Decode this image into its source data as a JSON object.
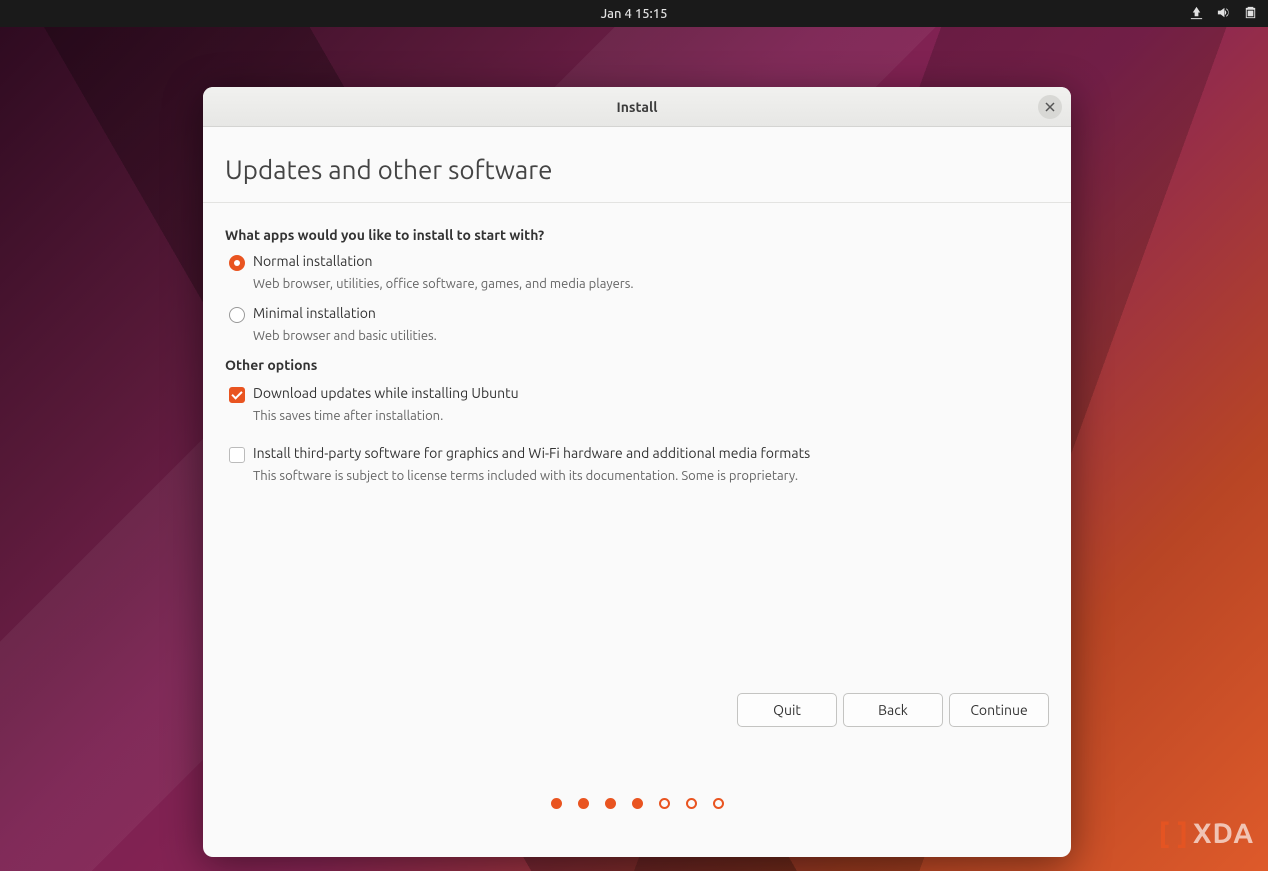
{
  "topbar": {
    "datetime": "Jan 4  15:15"
  },
  "window": {
    "title": "Install"
  },
  "page": {
    "heading": "Updates and other software",
    "question": "What apps would you like to install to start with?",
    "install_options": [
      {
        "label": "Normal installation",
        "desc": "Web browser, utilities, office software, games, and media players.",
        "selected": true
      },
      {
        "label": "Minimal installation",
        "desc": "Web browser and basic utilities.",
        "selected": false
      }
    ],
    "other_heading": "Other options",
    "other_options": [
      {
        "label": "Download updates while installing Ubuntu",
        "desc": "This saves time after installation.",
        "checked": true
      },
      {
        "label": "Install third-party software for graphics and Wi-Fi hardware and additional media formats",
        "desc": "This software is subject to license terms included with its documentation. Some is proprietary.",
        "checked": false
      }
    ]
  },
  "buttons": {
    "quit": "Quit",
    "back": "Back",
    "continue": "Continue"
  },
  "progress": {
    "total": 7,
    "current": 4
  },
  "watermark": "XDA"
}
